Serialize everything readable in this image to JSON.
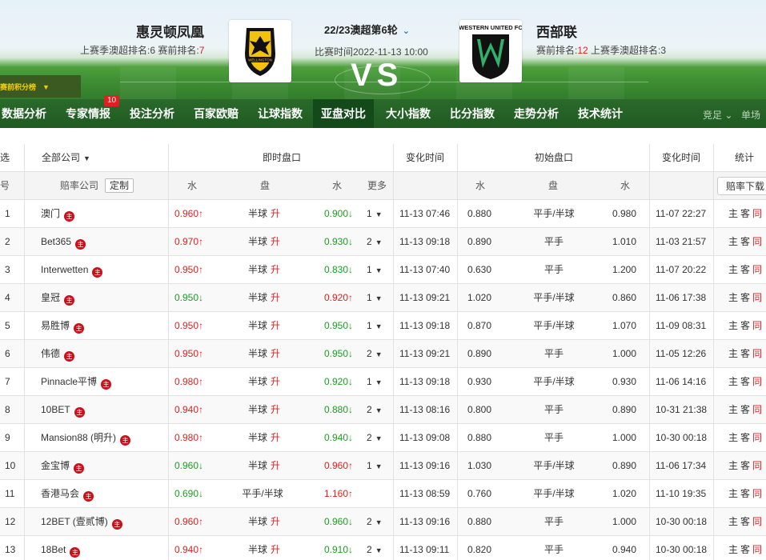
{
  "header": {
    "home_team": "惠灵顿凤凰",
    "home_rank_label": "上赛季澳超排名:6   赛前排名:",
    "home_rank_value": "7",
    "home_logo_text": "WELLINGTON",
    "round": "22/23澳超第6轮",
    "match_time": "比赛时间2022-11-13 10:00",
    "vs": "VS",
    "away_team": "西部联",
    "away_rank_label": "赛前排名:",
    "away_rank_value": "12",
    "away_rank_extra": "   上赛季澳超排名:3",
    "away_logo_text": "WESTERN UNITED FC",
    "away_logo_letter": "W"
  },
  "rank_button": "赛前积分榜",
  "nav": {
    "items": [
      {
        "label": "数据分析"
      },
      {
        "label": "专家情报",
        "badge": "10"
      },
      {
        "label": "投注分析"
      },
      {
        "label": "百家欧赔"
      },
      {
        "label": "让球指数"
      },
      {
        "label": "亚盘对比",
        "active": true
      },
      {
        "label": "大小指数"
      },
      {
        "label": "比分指数"
      },
      {
        "label": "走势分析"
      },
      {
        "label": "技术统计"
      }
    ],
    "mini1": "竞足",
    "mini2": "单场"
  },
  "table": {
    "head1": {
      "select": "选",
      "company_filter": "全部公司",
      "live": "即时盘口",
      "change_time": "变化时间",
      "initial": "初始盘口",
      "change_time2": "变化时间",
      "stats": "统计"
    },
    "head2": {
      "no": "号",
      "company": "赔率公司",
      "custom": "定制",
      "water1": "水",
      "line": "盘",
      "water2": "水",
      "more": "更多",
      "i_water1": "水",
      "i_line": "盘",
      "i_water2": "水",
      "download": "赔率下载"
    },
    "rows": [
      {
        "no": "1",
        "company": "澳门",
        "w1": "0.960↑",
        "w1d": "up",
        "line": "半球",
        "lchg": "升",
        "w2": "0.900↓",
        "w2d": "down",
        "more": "1",
        "time": "11-13 07:46",
        "iw1": "0.880",
        "iline": "平手/半球",
        "iw2": "0.980",
        "itime": "11-07 22:27"
      },
      {
        "no": "2",
        "company": "Bet365",
        "w1": "0.970↑",
        "w1d": "up",
        "line": "半球",
        "lchg": "升",
        "w2": "0.930↓",
        "w2d": "down",
        "more": "2",
        "time": "11-13 09:18",
        "iw1": "0.890",
        "iline": "平手",
        "iw2": "1.010",
        "itime": "11-03 21:57"
      },
      {
        "no": "3",
        "company": "Interwetten",
        "w1": "0.950↑",
        "w1d": "up",
        "line": "半球",
        "lchg": "升",
        "w2": "0.830↓",
        "w2d": "down",
        "more": "1",
        "time": "11-13 07:40",
        "iw1": "0.630",
        "iline": "平手",
        "iw2": "1.200",
        "itime": "11-07 20:22"
      },
      {
        "no": "4",
        "company": "皇冠",
        "w1": "0.950↓",
        "w1d": "down",
        "line": "半球",
        "lchg": "升",
        "w2": "0.920↑",
        "w2d": "up",
        "more": "1",
        "time": "11-13 09:21",
        "iw1": "1.020",
        "iline": "平手/半球",
        "iw2": "0.860",
        "itime": "11-06 17:38"
      },
      {
        "no": "5",
        "company": "易胜博",
        "w1": "0.950↑",
        "w1d": "up",
        "line": "半球",
        "lchg": "升",
        "w2": "0.950↓",
        "w2d": "down",
        "more": "1",
        "time": "11-13 09:18",
        "iw1": "0.870",
        "iline": "平手/半球",
        "iw2": "1.070",
        "itime": "11-09 08:31"
      },
      {
        "no": "6",
        "company": "伟德",
        "w1": "0.950↑",
        "w1d": "up",
        "line": "半球",
        "lchg": "升",
        "w2": "0.950↓",
        "w2d": "down",
        "more": "2",
        "time": "11-13 09:21",
        "iw1": "0.890",
        "iline": "平手",
        "iw2": "1.000",
        "itime": "11-05 12:26"
      },
      {
        "no": "7",
        "company": "Pinnacle平博",
        "w1": "0.980↑",
        "w1d": "up",
        "line": "半球",
        "lchg": "升",
        "w2": "0.920↓",
        "w2d": "down",
        "more": "1",
        "time": "11-13 09:18",
        "iw1": "0.930",
        "iline": "平手/半球",
        "iw2": "0.930",
        "itime": "11-06 14:16"
      },
      {
        "no": "8",
        "company": "10BET",
        "w1": "0.940↑",
        "w1d": "up",
        "line": "半球",
        "lchg": "升",
        "w2": "0.880↓",
        "w2d": "down",
        "more": "2",
        "time": "11-13 08:16",
        "iw1": "0.800",
        "iline": "平手",
        "iw2": "0.890",
        "itime": "10-31 21:38"
      },
      {
        "no": "9",
        "company": "Mansion88 (明升)",
        "w1": "0.980↑",
        "w1d": "up",
        "line": "半球",
        "lchg": "升",
        "w2": "0.940↓",
        "w2d": "down",
        "more": "2",
        "time": "11-13 09:08",
        "iw1": "0.880",
        "iline": "平手",
        "iw2": "1.000",
        "itime": "10-30 00:18"
      },
      {
        "no": "10",
        "company": "金宝博",
        "w1": "0.960↓",
        "w1d": "down",
        "line": "半球",
        "lchg": "升",
        "w2": "0.960↑",
        "w2d": "up",
        "more": "1",
        "time": "11-13 09:16",
        "iw1": "1.030",
        "iline": "平手/半球",
        "iw2": "0.890",
        "itime": "11-06 17:34"
      },
      {
        "no": "11",
        "company": "香港马会",
        "w1": "0.690↓",
        "w1d": "down",
        "line": "平手/半球",
        "lchg": "",
        "w2": "1.160↑",
        "w2d": "up",
        "more": "",
        "time": "11-13 08:59",
        "iw1": "0.760",
        "iline": "平手/半球",
        "iw2": "1.020",
        "itime": "11-10 19:35"
      },
      {
        "no": "12",
        "company": "12BET (壹贰博)",
        "w1": "0.960↑",
        "w1d": "up",
        "line": "半球",
        "lchg": "升",
        "w2": "0.960↓",
        "w2d": "down",
        "more": "2",
        "time": "11-13 09:16",
        "iw1": "0.880",
        "iline": "平手",
        "iw2": "1.000",
        "itime": "10-30 00:18"
      },
      {
        "no": "13",
        "company": "18Bet",
        "w1": "0.940↑",
        "w1d": "up",
        "line": "半球",
        "lchg": "升",
        "w2": "0.910↓",
        "w2d": "down",
        "more": "2",
        "time": "11-13 09:11",
        "iw1": "0.820",
        "iline": "平手",
        "iw2": "0.940",
        "itime": "10-30 00:18"
      }
    ],
    "stat_home": "主",
    "stat_away": "客",
    "stat_same": "同"
  },
  "colors": {
    "up": "#e02020",
    "down": "#1aa020",
    "nav_bg": "#1f5a22",
    "badge": "#e02020"
  },
  "icons": {
    "company": "company-badge-icon",
    "dropdown": "caret-down-icon"
  }
}
